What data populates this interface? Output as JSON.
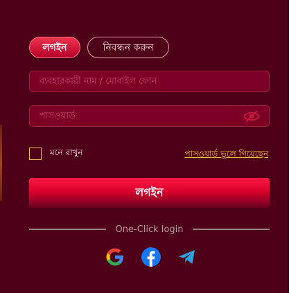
{
  "tabs": [
    {
      "label": "লগইন"
    },
    {
      "label": "নিবন্ধন করুন"
    }
  ],
  "form": {
    "username_placeholder": "ব্যবহারকারী নাম / মোবাইল ফোন",
    "password_placeholder": "পাসওয়ার্ড",
    "remember_label": "মনে রাখুন",
    "forgot_label": "পাসওয়ার্ড ভুলে গিয়েছেন",
    "login_button": "লগইন"
  },
  "oneclick": {
    "label": "One-Click login",
    "providers": [
      {
        "name": "google-icon"
      },
      {
        "name": "facebook-icon"
      },
      {
        "name": "telegram-icon"
      }
    ]
  },
  "colors": {
    "panel": "#4e0019",
    "field": "#7c0026",
    "accent": "#e6003a",
    "gold": "#f0c040"
  }
}
